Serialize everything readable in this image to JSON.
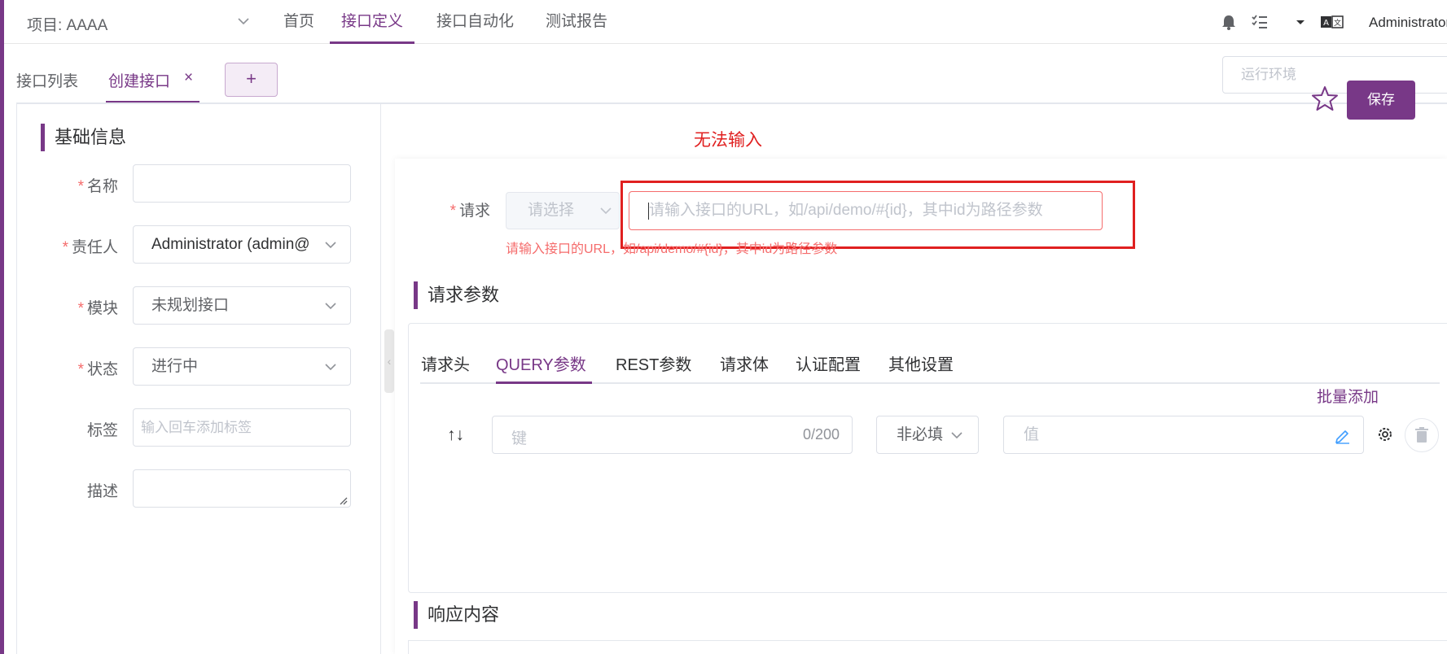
{
  "header": {
    "project": "项目: AAAA",
    "nav": [
      "首页",
      "接口定义",
      "接口自动化",
      "测试报告"
    ],
    "active_nav": 1,
    "user": "Administrator"
  },
  "tabs": {
    "list": "接口列表",
    "create": "创建接口",
    "close": "×",
    "add": "+"
  },
  "toolbar": {
    "env_placeholder": "运行环境",
    "save": "保存"
  },
  "basic": {
    "title": "基础信息",
    "required_mark": "*",
    "fields": {
      "name_label": "名称",
      "name_value": "",
      "owner_label": "责任人",
      "owner_value": "Administrator (admin@",
      "module_label": "模块",
      "module_value": "未规划接口",
      "status_label": "状态",
      "status_value": "进行中",
      "tags_label": "标签",
      "tags_placeholder": "输入回车添加标签",
      "desc_label": "描述",
      "desc_value": ""
    }
  },
  "annotation": "无法输入",
  "request": {
    "label": "请求",
    "method_placeholder": "请选择",
    "url_placeholder": "请输入接口的URL，如/api/demo/#{id}，其中id为路径参数",
    "url_error": "请输入接口的URL，如/api/demo/#{id}，其中id为路径参数"
  },
  "params": {
    "title": "请求参数",
    "tabs": [
      "请求头",
      "QUERY参数",
      "REST参数",
      "请求体",
      "认证配置",
      "其他设置"
    ],
    "active_tab": 1,
    "batch_add": "批量添加",
    "sort_arrows": "↑↓",
    "key_placeholder": "键",
    "key_count": "0/200",
    "required_value": "非必填",
    "value_placeholder": "值"
  },
  "response": {
    "title": "响应内容"
  },
  "colors": {
    "primary": "#783887",
    "error": "#f56c6c",
    "annotation": "#e02020"
  }
}
